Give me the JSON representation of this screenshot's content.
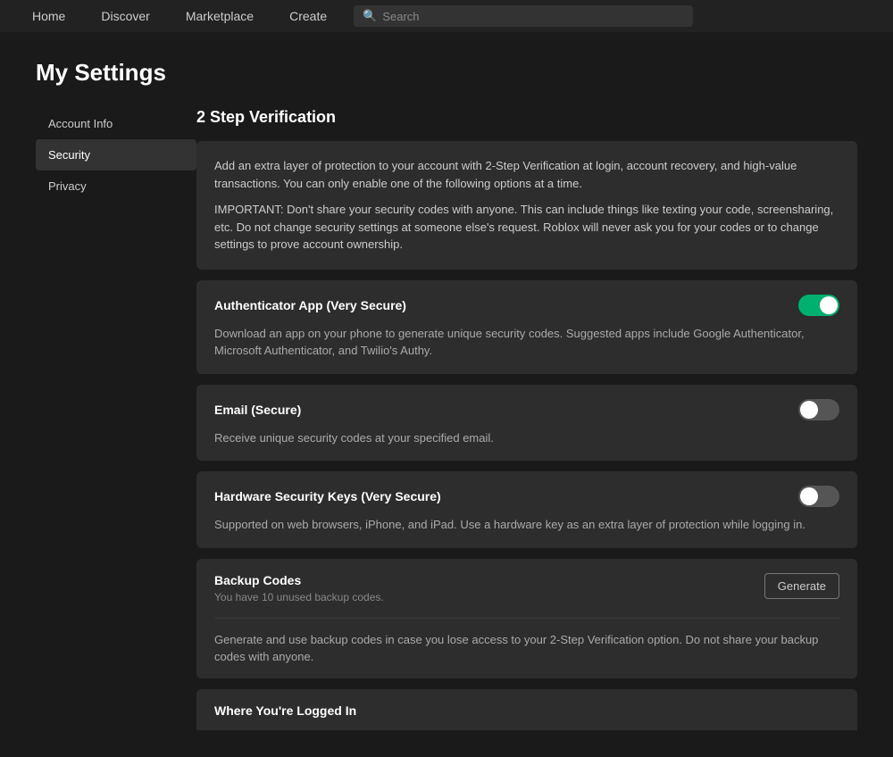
{
  "nav": {
    "items": [
      {
        "label": "Home",
        "id": "home"
      },
      {
        "label": "Discover",
        "id": "discover"
      },
      {
        "label": "Marketplace",
        "id": "marketplace"
      },
      {
        "label": "Create",
        "id": "create"
      }
    ],
    "search_placeholder": "Search"
  },
  "page": {
    "title": "My Settings"
  },
  "sidebar": {
    "items": [
      {
        "label": "Account Info",
        "id": "account-info",
        "active": false
      },
      {
        "label": "Security",
        "id": "security",
        "active": true
      },
      {
        "label": "Privacy",
        "id": "privacy",
        "active": false
      }
    ]
  },
  "content": {
    "section_title": "2 Step Verification",
    "info_paragraphs": [
      "Add an extra layer of protection to your account with 2-Step Verification at login, account recovery, and high-value transactions. You can only enable one of the following options at a time.",
      "IMPORTANT: Don't share your security codes with anyone. This can include things like texting your code, screensharing, etc. Do not change security settings at someone else's request. Roblox will never ask you for your codes or to change settings to prove account ownership."
    ],
    "options": [
      {
        "id": "authenticator",
        "title": "Authenticator App (Very Secure)",
        "description": "Download an app on your phone to generate unique security codes. Suggested apps include Google Authenticator, Microsoft Authenticator, and Twilio's Authy.",
        "enabled": true
      },
      {
        "id": "email",
        "title": "Email (Secure)",
        "description": "Receive unique security codes at your specified email.",
        "enabled": false
      },
      {
        "id": "hardware",
        "title": "Hardware Security Keys (Very Secure)",
        "description": "Supported on web browsers, iPhone, and iPad. Use a hardware key as an extra layer of protection while logging in.",
        "enabled": false
      }
    ],
    "backup": {
      "title": "Backup Codes",
      "subtitle": "You have 10 unused backup codes.",
      "generate_label": "Generate",
      "description": "Generate and use backup codes in case you lose access to your 2-Step Verification option. Do not share your backup codes with anyone."
    },
    "bottom_partial_title": "Where You're Logged In"
  }
}
